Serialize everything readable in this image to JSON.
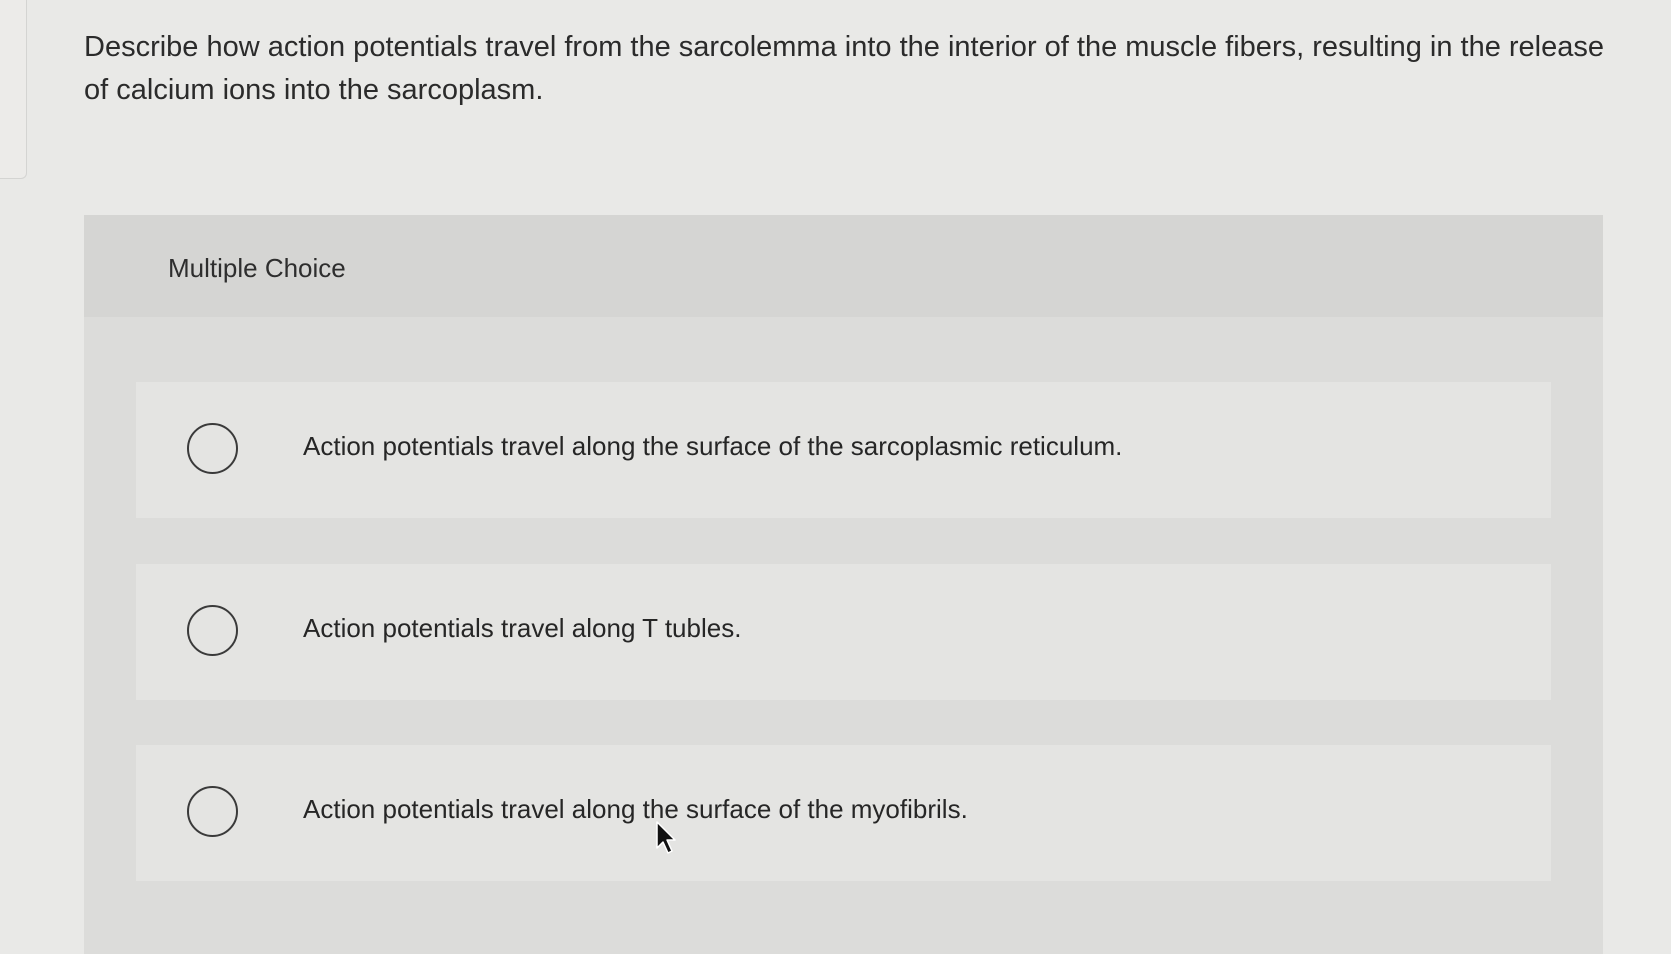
{
  "question": {
    "text": "Describe how action potentials travel from the sarcolemma into the interior of the muscle fibers, resulting in the release of calcium ions into the sarcoplasm."
  },
  "multiple_choice": {
    "title": "Multiple Choice",
    "options": [
      {
        "label": "Action potentials travel along the surface of the sarcoplasmic reticulum.",
        "selected": false
      },
      {
        "label": "Action potentials travel along T tubles.",
        "selected": false
      },
      {
        "label": "Action potentials travel along the surface of the myofibrils.",
        "selected": false
      }
    ]
  },
  "icons": {
    "radio": "radio-button-unchecked-icon",
    "cursor": "mouse-pointer-icon"
  },
  "colors": {
    "background": "#e9e9e7",
    "panel": "#dcdcda",
    "header": "#d5d5d3",
    "option": "#e4e4e2",
    "text": "#2a2a2a"
  }
}
